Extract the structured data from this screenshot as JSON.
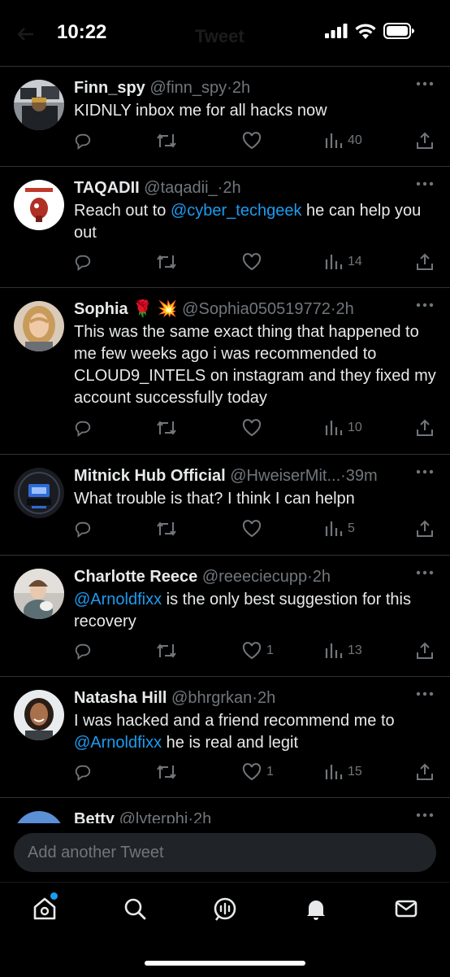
{
  "status": {
    "time": "10:22",
    "screen_title": "Tweet"
  },
  "tweets": [
    {
      "name": "Finn_spy",
      "handle": "@finn_spy",
      "time": "2h",
      "text_parts": [
        "KIDNLY inbox me for all hacks now"
      ],
      "replies": "",
      "retweets": "",
      "likes": "",
      "views": "40"
    },
    {
      "name": "TAQADII",
      "handle": "@taqadii_",
      "time": "2h",
      "text_parts": [
        "Reach out to ",
        "@cyber_techgeek",
        " he can help you out"
      ],
      "replies": "",
      "retweets": "",
      "likes": "",
      "views": "14"
    },
    {
      "name": "Sophia",
      "emoji": "🌹 💥",
      "handle": "@Sophia050519772",
      "time": "2h",
      "text_parts": [
        "This was the same exact thing that happened to me few weeks ago i was recommended to CLOUD9_INTELS on instagram and they fixed my account successfully today"
      ],
      "replies": "",
      "retweets": "",
      "likes": "",
      "views": "10"
    },
    {
      "name": "Mitnick Hub Official",
      "handle": "@HweiserMit...",
      "time": "39m",
      "text_parts": [
        "What trouble is that? I think I can helpn"
      ],
      "replies": "",
      "retweets": "",
      "likes": "",
      "views": "5"
    },
    {
      "name": "Charlotte Reece",
      "handle": "@reeeciecupp",
      "time": "2h",
      "text_parts": [
        "",
        "@Arnoldfixx",
        " is the only best suggestion for this recovery"
      ],
      "replies": "",
      "retweets": "",
      "likes": "1",
      "views": "13"
    },
    {
      "name": "Natasha Hill",
      "handle": "@bhrgrkan",
      "time": "2h",
      "text_parts": [
        "I was hacked and a friend recommend me to ",
        "@Arnoldfixx",
        "  he is real and legit"
      ],
      "replies": "",
      "retweets": "",
      "likes": "1",
      "views": "15"
    },
    {
      "name": "Betty",
      "handle": "@lyterphi",
      "time": "2h",
      "text_parts": [
        ""
      ],
      "replies": "",
      "retweets": "",
      "likes": "",
      "views": ""
    }
  ],
  "reply_bar": {
    "placeholder": "Add another Tweet"
  },
  "tabs": [
    {
      "icon": "home-icon",
      "badge": true
    },
    {
      "icon": "search-icon"
    },
    {
      "icon": "spaces-icon"
    },
    {
      "icon": "notifications-icon"
    },
    {
      "icon": "messages-icon"
    }
  ],
  "colors": {
    "background": "#000000",
    "accent": "#1d9bf0",
    "muted": "#71767b",
    "text": "#e7e9ea"
  }
}
